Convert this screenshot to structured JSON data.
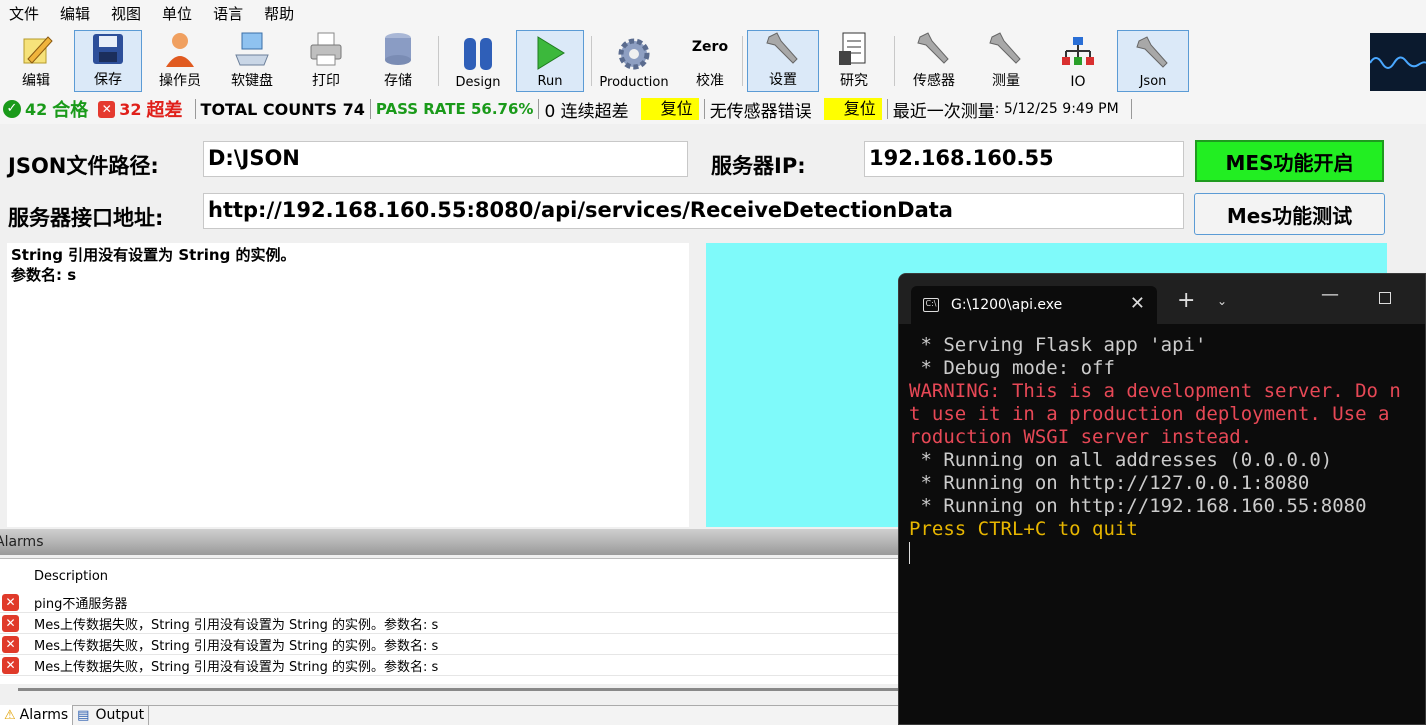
{
  "menu": [
    "文件",
    "编辑",
    "视图",
    "单位",
    "语言",
    "帮助"
  ],
  "toolbar": [
    {
      "label": "编辑",
      "icon": "pencil-icon"
    },
    {
      "label": "保存",
      "icon": "floppy-disk-icon"
    },
    {
      "label": "操作员",
      "icon": "user-icon"
    },
    {
      "label": "软键盘",
      "icon": "keyboard-computer-icon"
    },
    {
      "label": "打印",
      "icon": "printer-icon"
    },
    {
      "label": "存储",
      "icon": "database-icon"
    },
    {
      "label": "Design",
      "icon": "pause-icon"
    },
    {
      "label": "Run",
      "icon": "play-icon"
    },
    {
      "label": "Production",
      "icon": "gear-icon"
    },
    {
      "label": "校准",
      "icon": "zero-icon",
      "icon_text": "Zero"
    },
    {
      "label": "设置",
      "icon": "wrench-icon"
    },
    {
      "label": "研究",
      "icon": "document-icon"
    },
    {
      "label": "传感器",
      "icon": "wrench-icon"
    },
    {
      "label": "测量",
      "icon": "wrench-icon"
    },
    {
      "label": "IO",
      "icon": "network-icon"
    },
    {
      "label": "Json",
      "icon": "wrench-icon"
    }
  ],
  "status": {
    "pass_count": "42",
    "pass_label": "合格",
    "fail_count": "32",
    "fail_label": "超差",
    "total": "TOTAL COUNTS 74",
    "pass_rate": "PASS RATE 56.76%",
    "consecutive": "0 连续超差",
    "reset1": "复位",
    "sensor_error": "无传感器错误",
    "reset2": "复位",
    "last_label": "最近一次测量",
    "last_value": ": 5/12/25 9:49 PM"
  },
  "form": {
    "json_path_label": "JSON文件路径:",
    "json_path_value": "D:\\JSON",
    "server_ip_label": "服务器IP:",
    "server_ip_value": "192.168.160.55",
    "mes_enable_button": "MES功能开启",
    "api_label": "服务器接口地址:",
    "api_value": "http://192.168.160.55:8080/api/services/ReceiveDetectionData",
    "mes_test_button": "Mes功能测试"
  },
  "message": {
    "line1": "String 引用没有设置为 String 的实例。",
    "line2": "参数名: s"
  },
  "alarms": {
    "title": "Alarms",
    "column": "Description",
    "rows": [
      "ping不通服务器",
      "Mes上传数据失败，String 引用没有设置为 String 的实例。参数名: s",
      "Mes上传数据失败，String 引用没有设置为 String 的实例。参数名: s",
      "Mes上传数据失败，String 引用没有设置为 String 的实例。参数名: s"
    ]
  },
  "bottom_tabs": [
    "Alarms",
    "Output"
  ],
  "terminal": {
    "tab_title": "G:\\1200\\api.exe",
    "lines": [
      {
        "text": " * Serving Flask app 'api'",
        "color": "#cccccc"
      },
      {
        "text": " * Debug mode: off",
        "color": "#cccccc"
      },
      {
        "text": "WARNING: This is a development server. Do n",
        "color": "#e74856"
      },
      {
        "text": "t use it in a production deployment. Use a",
        "color": "#e74856"
      },
      {
        "text": "roduction WSGI server instead.",
        "color": "#e74856"
      },
      {
        "text": " * Running on all addresses (0.0.0.0)",
        "color": "#cccccc"
      },
      {
        "text": " * Running on http://127.0.0.1:8080",
        "color": "#cccccc"
      },
      {
        "text": " * Running on http://192.168.160.55:8080",
        "color": "#cccccc"
      },
      {
        "text": "Press CTRL+C to quit",
        "color": "#e7b600"
      }
    ]
  }
}
